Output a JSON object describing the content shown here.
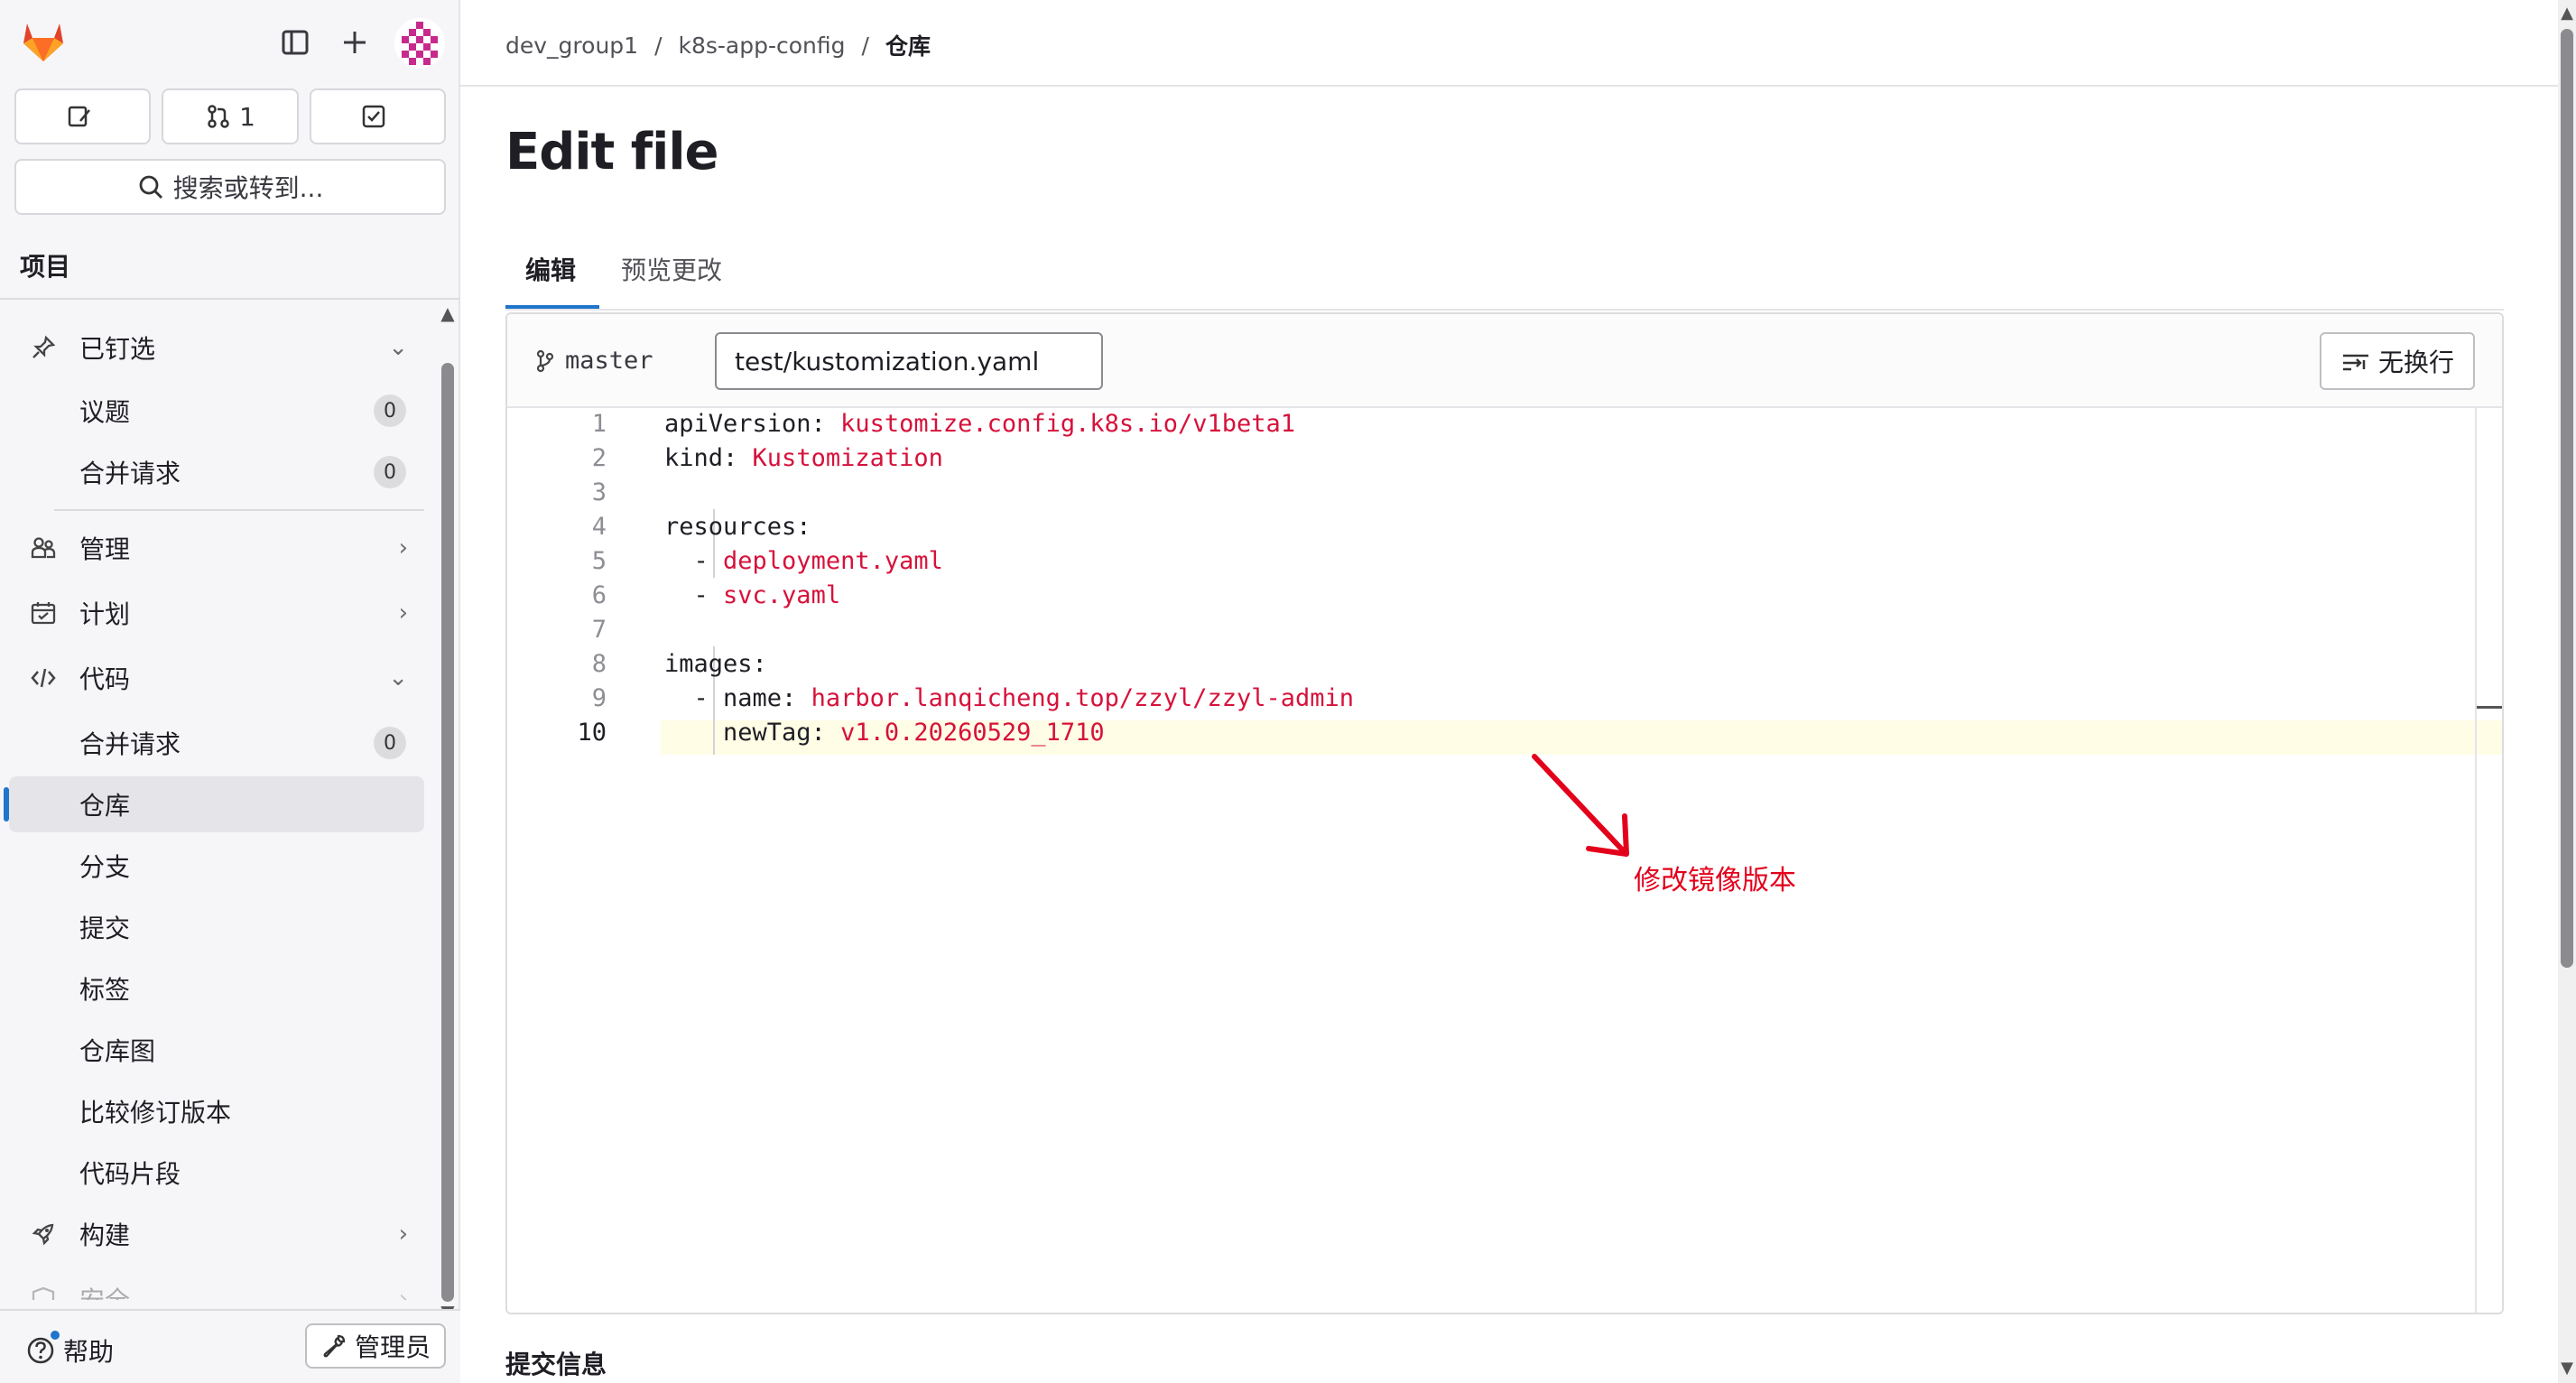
{
  "colors": {
    "accent": "#1f75cb",
    "code_value": "#d6123b",
    "annotation": "#e3001b",
    "current_line": "#fffde5",
    "gitlab_orange": "#e24329"
  },
  "sidebar": {
    "pills": [
      {
        "icon": "edit-icon",
        "label": ""
      },
      {
        "icon": "merge-request-icon",
        "label": "1"
      },
      {
        "icon": "todo-check-icon",
        "label": ""
      }
    ],
    "search_label": "搜索或转到...",
    "section_title": "项目",
    "nav": {
      "pinned": "已钉选",
      "issues": "议题",
      "issues_count": "0",
      "mr_pinned": "合并请求",
      "mr_pinned_count": "0",
      "manage": "管理",
      "plan": "计划",
      "code": "代码",
      "mr": "合并请求",
      "mr_count": "0",
      "repository": "仓库",
      "branches": "分支",
      "commits": "提交",
      "tags": "标签",
      "graph": "仓库图",
      "compare": "比较修订版本",
      "snippets": "代码片段",
      "build": "构建",
      "secure": "安全"
    },
    "help": "帮助",
    "admin": "管理员"
  },
  "breadcrumb": {
    "group": "dev_group1",
    "project": "k8s-app-config",
    "current": "仓库",
    "separator": "/"
  },
  "page_title": "Edit file",
  "tabs": {
    "edit": "编辑",
    "preview": "预览更改"
  },
  "editor": {
    "branch": "master",
    "filename": "test/kustomization.yaml",
    "nowrap_label": "无换行",
    "lines": [
      {
        "n": "1",
        "key": "apiVersion: ",
        "val": "kustomize.config.k8s.io/v1beta1"
      },
      {
        "n": "2",
        "key": "kind: ",
        "val": "Kustomization"
      },
      {
        "n": "3",
        "key": "",
        "val": ""
      },
      {
        "n": "4",
        "key": "resources:",
        "val": ""
      },
      {
        "n": "5",
        "key": "  - ",
        "val": "deployment.yaml"
      },
      {
        "n": "6",
        "key": "  - ",
        "val": "svc.yaml"
      },
      {
        "n": "7",
        "key": "",
        "val": ""
      },
      {
        "n": "8",
        "key": "images:",
        "val": ""
      },
      {
        "n": "9",
        "key": "  - name: ",
        "val": "harbor.lanqicheng.top/zzyl/zzyl-admin"
      },
      {
        "n": "10",
        "key": "    newTag: ",
        "val": "v1.0.20260529_1710"
      }
    ],
    "current_line": "10"
  },
  "annotation": "修改镜像版本",
  "commit_section_title": "提交信息"
}
